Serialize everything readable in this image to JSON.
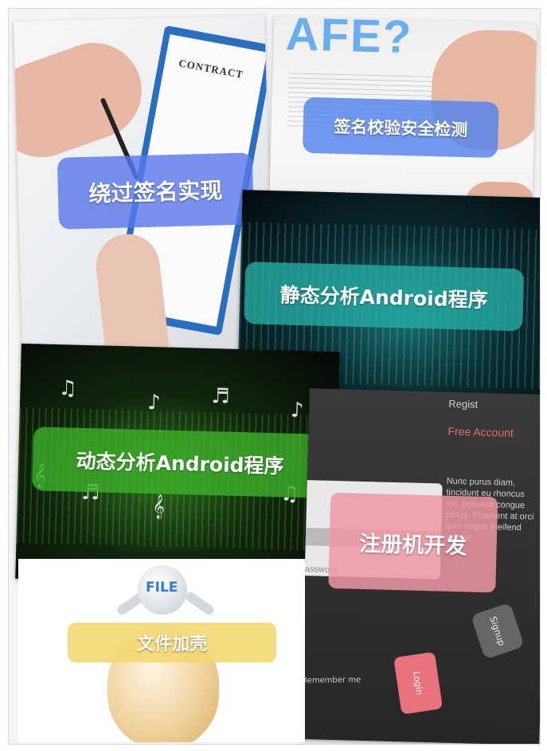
{
  "panels": {
    "bypass": {
      "label": "绕过签名实现",
      "paper_text": "CONTRACT",
      "color": "#5a78eb"
    },
    "check": {
      "label": "签名校验安全检测",
      "bg_text": "AFE?",
      "color": "#5082eb"
    },
    "static": {
      "label": "静态分析Android程序",
      "color": "#23aaa0"
    },
    "dynamic": {
      "label": "动态分析Android程序",
      "color": "#3caf28"
    },
    "register": {
      "label": "注册机开发",
      "heading": "Regist",
      "sub_heading": "Free Account",
      "body_text": "Nunc purus diam, tincidunt eu rhoncus vel, posuere congue purus. Praesent at orci quis neque eleifend laoreet.",
      "password_placeholder": "assword",
      "remember": "Remember me",
      "signup": "Signup",
      "login": "Login",
      "color": "#f096a5"
    },
    "packing": {
      "label": "文件加壳",
      "file_text": "FILE",
      "color": "#f5d76e"
    }
  }
}
